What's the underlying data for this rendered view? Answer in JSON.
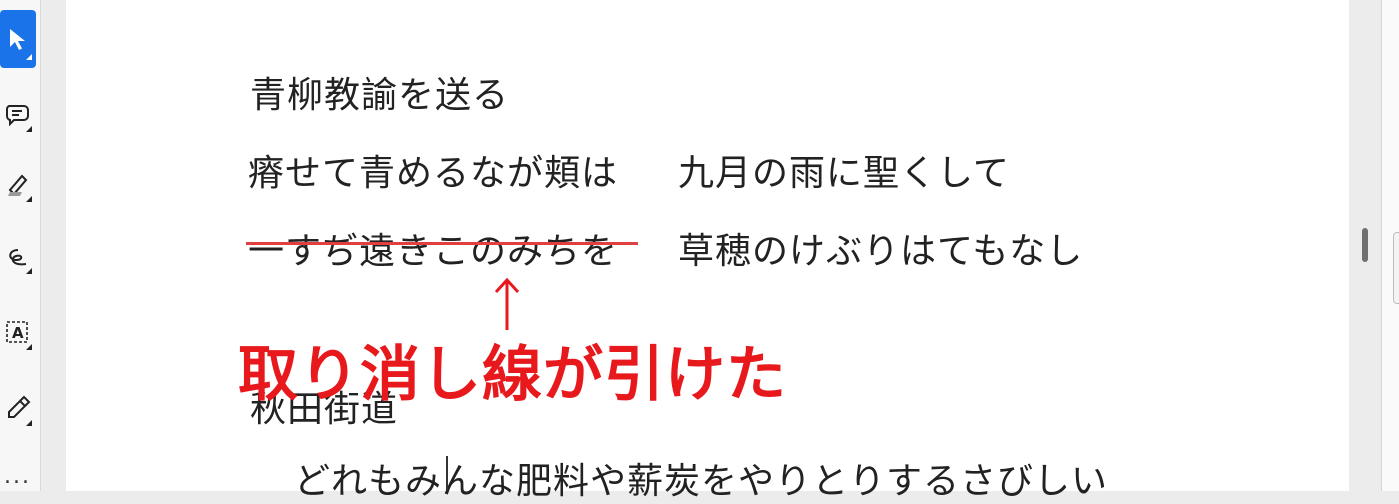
{
  "toolbar": {
    "tools": [
      {
        "name": "select",
        "icon": "pointer-arrow-icon",
        "active": true
      },
      {
        "name": "comment",
        "icon": "comment-bubble-icon"
      },
      {
        "name": "highlight",
        "icon": "highlighter-pen-icon"
      },
      {
        "name": "draw",
        "icon": "freehand-draw-icon"
      },
      {
        "name": "text-box",
        "icon": "text-box-icon",
        "label": "A"
      },
      {
        "name": "stamp",
        "icon": "stamp-pen-icon"
      }
    ],
    "more_label": "..."
  },
  "document": {
    "title1": "青柳教諭を送る",
    "poem": [
      {
        "left": "瘠せて青めるなが頬は",
        "right": "九月の雨に聖くして"
      },
      {
        "left": "一すぢ遠きこのみちを",
        "right": "草穂のけぶりはてもなし"
      }
    ],
    "title2": "秋田街道",
    "body_line": "どれもみんな肥料や薪炭をやりとりするさびしい"
  },
  "annotation": {
    "text": "取り消し線が引けた",
    "arrow": "↑",
    "color": "#e8191d"
  },
  "colors": {
    "accent": "#1a73e8",
    "strikethrough": "#e04040"
  }
}
